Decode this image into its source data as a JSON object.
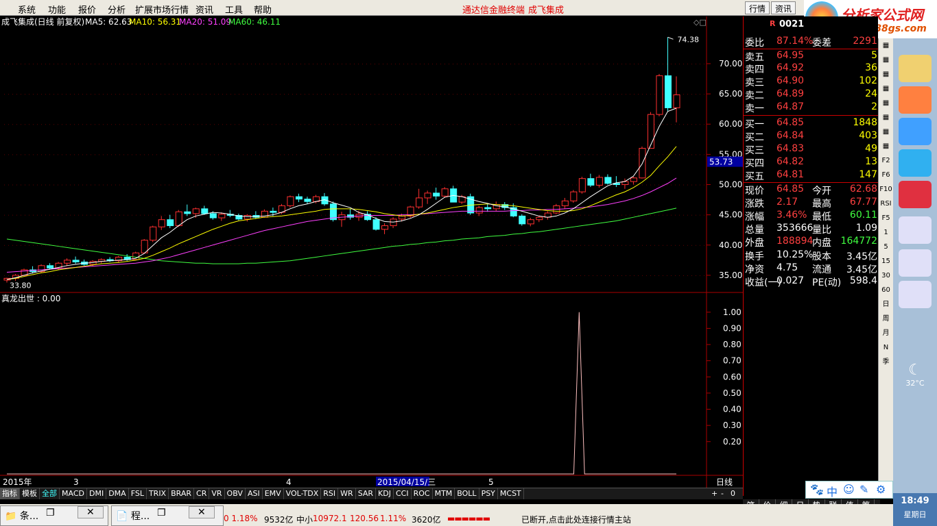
{
  "menu": {
    "items": [
      "系统",
      "功能",
      "报价",
      "分析",
      "扩展市场行情",
      "资讯",
      "工具",
      "帮助"
    ],
    "center": "通达信金融终端",
    "center2": "成飞集成",
    "btn1": "行情",
    "btn2": "资讯"
  },
  "logo": {
    "text": "分析家公式网",
    "url": "www.88gs.com"
  },
  "header": {
    "title": "成飞集成(日线 前复权)",
    "ma5": "MA5: 62.63",
    "ma10": "MA10: 56.31",
    "ma20": "MA20: 51.09",
    "ma60": "MA60: 46.11"
  },
  "colors": {
    "up": "#ff3030",
    "down": "#40ffff",
    "ma5": "#ffffff",
    "ma10": "#ffff00",
    "ma20": "#ff40ff",
    "ma60": "#40ff40",
    "grid": "#aa0000"
  },
  "chart_data": [
    {
      "type": "candlestick",
      "title": "成飞集成(日线 前复权)",
      "ylim": [
        32.5,
        76
      ],
      "yticks": [
        35,
        40,
        45,
        50,
        55,
        60,
        65,
        70
      ],
      "ytick_labels": [
        "35.00",
        "40.00",
        "45.00",
        "50.00",
        "55.00",
        "60.00",
        "65.00",
        "70.00"
      ],
      "high_label": "74.38",
      "low_label": "33.80",
      "price_marker": "53.73",
      "x_labels": [
        "2015年",
        "3",
        "4",
        "2015/04/15/三",
        "5",
        "日线"
      ],
      "candles": [
        [
          34.2,
          34.6,
          33.8,
          34.5
        ],
        [
          34.5,
          35.2,
          34.1,
          35.0
        ],
        [
          35.0,
          36.1,
          34.8,
          35.9
        ],
        [
          35.9,
          36.5,
          35.3,
          35.6
        ],
        [
          35.6,
          36.8,
          35.4,
          36.6
        ],
        [
          36.6,
          37.0,
          36.0,
          36.2
        ],
        [
          36.2,
          37.2,
          35.9,
          37.0
        ],
        [
          37.0,
          37.8,
          36.5,
          37.5
        ],
        [
          37.5,
          38.1,
          36.9,
          37.2
        ],
        [
          37.2,
          37.6,
          36.6,
          36.8
        ],
        [
          36.8,
          37.5,
          36.5,
          37.3
        ],
        [
          37.3,
          37.8,
          37.0,
          37.6
        ],
        [
          37.6,
          38.0,
          37.2,
          37.4
        ],
        [
          37.4,
          38.2,
          37.1,
          38.0
        ],
        [
          38.0,
          38.5,
          37.4,
          37.6
        ],
        [
          37.6,
          38.9,
          37.5,
          38.7
        ],
        [
          38.7,
          41.0,
          38.6,
          40.8
        ],
        [
          40.8,
          43.2,
          40.5,
          43.0
        ],
        [
          43.0,
          44.8,
          42.5,
          44.2
        ],
        [
          44.2,
          45.0,
          42.8,
          43.2
        ],
        [
          43.2,
          45.8,
          43.0,
          45.5
        ],
        [
          45.5,
          46.7,
          44.8,
          45.2
        ],
        [
          45.2,
          46.2,
          44.5,
          46.0
        ],
        [
          46.0,
          46.5,
          45.0,
          45.2
        ],
        [
          45.2,
          45.6,
          44.2,
          44.5
        ],
        [
          44.5,
          45.4,
          44.0,
          45.1
        ],
        [
          45.1,
          45.8,
          44.6,
          44.9
        ],
        [
          44.9,
          45.2,
          44.1,
          44.3
        ],
        [
          44.3,
          45.1,
          43.9,
          44.9
        ],
        [
          44.9,
          45.6,
          44.3,
          44.6
        ],
        [
          44.6,
          45.9,
          44.5,
          45.6
        ],
        [
          45.6,
          46.2,
          44.8,
          45.4
        ],
        [
          45.4,
          46.8,
          45.1,
          46.5
        ],
        [
          46.5,
          48.2,
          46.2,
          48.0
        ],
        [
          48.0,
          48.5,
          47.1,
          47.6
        ],
        [
          47.6,
          48.0,
          46.8,
          47.2
        ],
        [
          47.2,
          48.3,
          46.9,
          48.0
        ],
        [
          48.0,
          48.6,
          46.5,
          46.8
        ],
        [
          46.8,
          47.2,
          43.9,
          44.2
        ],
        [
          44.2,
          45.5,
          43.0,
          45.0
        ],
        [
          45.0,
          46.0,
          44.2,
          44.6
        ],
        [
          44.6,
          45.7,
          44.0,
          45.1
        ],
        [
          45.1,
          45.6,
          44.0,
          44.2
        ],
        [
          44.2,
          44.6,
          42.4,
          42.6
        ],
        [
          42.6,
          43.6,
          41.8,
          43.2
        ],
        [
          43.2,
          44.6,
          42.8,
          44.3
        ],
        [
          44.3,
          45.2,
          43.9,
          44.8
        ],
        [
          44.8,
          46.5,
          44.5,
          46.3
        ],
        [
          46.3,
          49.3,
          46.0,
          47.8
        ],
        [
          47.8,
          49.0,
          46.8,
          48.6
        ],
        [
          48.6,
          49.5,
          47.5,
          48.1
        ],
        [
          48.1,
          49.6,
          47.8,
          49.3
        ],
        [
          49.3,
          49.8,
          47.5,
          47.1
        ],
        [
          47.1,
          48.3,
          46.8,
          48.0
        ],
        [
          48.0,
          48.5,
          45.0,
          45.3
        ],
        [
          45.3,
          46.5,
          44.8,
          46.2
        ],
        [
          46.2,
          46.9,
          45.5,
          46.0
        ],
        [
          46.0,
          47.2,
          45.6,
          46.7
        ],
        [
          46.7,
          47.1,
          45.8,
          46.2
        ],
        [
          46.2,
          46.9,
          44.6,
          44.8
        ],
        [
          44.8,
          45.1,
          43.2,
          43.5
        ],
        [
          43.5,
          44.5,
          43.1,
          44.2
        ],
        [
          44.2,
          44.8,
          43.8,
          44.6
        ],
        [
          44.6,
          45.6,
          44.2,
          45.3
        ],
        [
          45.3,
          46.8,
          45.1,
          46.5
        ],
        [
          46.5,
          47.8,
          46.0,
          47.3
        ],
        [
          47.3,
          49.1,
          47.0,
          48.8
        ],
        [
          48.8,
          51.3,
          48.5,
          51.0
        ],
        [
          51.0,
          51.8,
          49.6,
          49.9
        ],
        [
          49.9,
          51.6,
          49.5,
          51.2
        ],
        [
          51.2,
          51.7,
          50.0,
          50.2
        ],
        [
          50.2,
          51.4,
          49.6,
          50.0
        ],
        [
          50.0,
          51.0,
          49.3,
          50.5
        ],
        [
          50.5,
          51.3,
          50.0,
          51.1
        ],
        [
          51.1,
          56.3,
          51.0,
          56.0
        ],
        [
          56.0,
          62.0,
          58.2,
          61.6
        ],
        [
          61.6,
          68.3,
          61.3,
          68.0
        ],
        [
          68.0,
          74.38,
          62.1,
          62.7
        ],
        [
          62.7,
          67.9,
          60.3,
          64.85
        ]
      ],
      "ma5": [
        34.3,
        34.6,
        35.0,
        35.4,
        35.7,
        36.0,
        36.3,
        36.6,
        36.8,
        37.0,
        37.1,
        37.3,
        37.4,
        37.5,
        37.6,
        37.8,
        38.6,
        39.9,
        41.2,
        42.1,
        43.2,
        44.2,
        44.8,
        45.1,
        45.4,
        45.3,
        45.1,
        44.8,
        44.7,
        44.7,
        44.8,
        45.0,
        45.4,
        46.0,
        46.5,
        46.8,
        47.2,
        47.5,
        47.0,
        46.6,
        46.2,
        45.4,
        45.0,
        44.4,
        43.9,
        43.8,
        44.0,
        44.4,
        45.0,
        45.9,
        46.9,
        47.9,
        48.2,
        48.0,
        47.6,
        47.2,
        46.9,
        46.5,
        46.3,
        46.0,
        45.6,
        45.2,
        44.8,
        44.6,
        44.8,
        45.3,
        46.0,
        47.0,
        48.0,
        48.9,
        49.8,
        50.3,
        50.5,
        51.4,
        53.4,
        56.5,
        59.6,
        62.1,
        62.63
      ],
      "ma10": [
        34.3,
        34.5,
        34.8,
        35.1,
        35.4,
        35.6,
        35.9,
        36.1,
        36.3,
        36.5,
        36.7,
        36.9,
        37.0,
        37.1,
        37.3,
        37.5,
        37.8,
        38.3,
        38.9,
        39.5,
        40.2,
        40.8,
        41.4,
        42.0,
        42.6,
        43.1,
        43.6,
        44.0,
        44.2,
        44.4,
        44.6,
        44.7,
        44.8,
        45.0,
        45.2,
        45.4,
        45.6,
        45.9,
        46.0,
        46.0,
        46.0,
        45.9,
        45.7,
        45.5,
        45.2,
        45.0,
        44.8,
        44.9,
        45.1,
        45.3,
        45.6,
        45.9,
        46.2,
        46.4,
        46.6,
        46.7,
        46.8,
        46.7,
        46.6,
        46.5,
        46.3,
        46.1,
        45.9,
        45.7,
        45.6,
        45.6,
        45.7,
        46.0,
        46.5,
        47.1,
        47.7,
        48.3,
        48.8,
        49.5,
        50.4,
        51.5,
        53.1,
        54.6,
        56.31
      ],
      "ma20": [
        35.5,
        35.6,
        35.7,
        35.8,
        35.9,
        36.0,
        36.1,
        36.2,
        36.3,
        36.4,
        36.5,
        36.6,
        36.7,
        36.8,
        36.9,
        37.0,
        37.2,
        37.4,
        37.7,
        38.0,
        38.4,
        38.8,
        39.2,
        39.6,
        40.0,
        40.4,
        40.8,
        41.2,
        41.6,
        42.0,
        42.4,
        42.7,
        43.0,
        43.3,
        43.6,
        43.9,
        44.1,
        44.3,
        44.5,
        44.6,
        44.7,
        44.8,
        44.9,
        44.9,
        44.9,
        44.9,
        45.0,
        45.0,
        45.1,
        45.2,
        45.3,
        45.4,
        45.5,
        45.6,
        45.6,
        45.6,
        45.6,
        45.6,
        45.6,
        45.7,
        45.7,
        45.8,
        45.8,
        45.9,
        45.9,
        46.0,
        46.1,
        46.2,
        46.3,
        46.5,
        46.7,
        47.0,
        47.3,
        47.7,
        48.2,
        48.8,
        49.5,
        50.2,
        51.09
      ],
      "ma60": [
        41.0,
        40.8,
        40.6,
        40.4,
        40.2,
        40.0,
        39.8,
        39.6,
        39.4,
        39.2,
        39.0,
        38.8,
        38.6,
        38.4,
        38.2,
        38.0,
        37.8,
        37.6,
        37.4,
        37.3,
        37.2,
        37.1,
        37.0,
        37.0,
        36.9,
        36.9,
        36.9,
        36.9,
        37.0,
        37.0,
        37.1,
        37.2,
        37.3,
        37.4,
        37.6,
        37.8,
        38.0,
        38.2,
        38.4,
        38.6,
        38.8,
        39.0,
        39.2,
        39.4,
        39.6,
        39.8,
        39.9,
        40.1,
        40.2,
        40.4,
        40.5,
        40.7,
        40.8,
        41.0,
        41.1,
        41.2,
        41.4,
        41.5,
        41.6,
        41.8,
        41.9,
        42.1,
        42.2,
        42.4,
        42.6,
        42.8,
        43.0,
        43.2,
        43.4,
        43.6,
        43.8,
        44.0,
        44.3,
        44.6,
        44.9,
        45.2,
        45.5,
        45.8,
        46.11
      ]
    },
    {
      "type": "line",
      "title": "真龙出世 : 0.00",
      "ylim": [
        0,
        1.05
      ],
      "yticks": [
        0.2,
        0.3,
        0.4,
        0.5,
        0.6,
        0.7,
        0.8,
        0.9,
        1.0
      ],
      "ytick_labels": [
        "0.20",
        "0.30",
        "0.40",
        "0.50",
        "0.60",
        "0.70",
        "0.80",
        "0.90",
        "1.00"
      ],
      "values": [
        0,
        0,
        0,
        0,
        0,
        0,
        0,
        0,
        0,
        0,
        0,
        0,
        0,
        0,
        0,
        0,
        0,
        0,
        0,
        0,
        0,
        0,
        0,
        0,
        0,
        0,
        0,
        0,
        0,
        0,
        0,
        0,
        0,
        0,
        0,
        0,
        0,
        0,
        0,
        0,
        0,
        0,
        0,
        0,
        0,
        0,
        0,
        0,
        0,
        0,
        0,
        0,
        0,
        0,
        0,
        0,
        0,
        0,
        0,
        0,
        0,
        0,
        0,
        0,
        0,
        0,
        0,
        0,
        0,
        0,
        0,
        0,
        0,
        0,
        0,
        0,
        0,
        0,
        0,
        0,
        0,
        0,
        0,
        0,
        0,
        0,
        0,
        0,
        0,
        0,
        0,
        0,
        0,
        0,
        0,
        0,
        0,
        0,
        0,
        0,
        0,
        0,
        0,
        0,
        0,
        0,
        1,
        0,
        0,
        0,
        0,
        0,
        0,
        0,
        0,
        0,
        0,
        0,
        0,
        0,
        0,
        0,
        0,
        0,
        0
      ]
    }
  ],
  "tabs": [
    "指标",
    "模板",
    "全部",
    "MACD",
    "DMI",
    "DMA",
    "FSL",
    "TRIX",
    "BRAR",
    "CR",
    "VR",
    "OBV",
    "ASI",
    "EMV",
    "VOL-TDX",
    "RSI",
    "WR",
    "SAR",
    "KDJ",
    "CCI",
    "ROC",
    "MTM",
    "BOLL",
    "PSY",
    "MCST"
  ],
  "tabs_right": [
    "+",
    "-",
    "0"
  ],
  "quote": {
    "code": "0021",
    "flag": "R",
    "rows": [
      {
        "l": "委比",
        "p": "87.14%",
        "l2": "委差",
        "v": "2291"
      },
      {
        "l": "卖五",
        "p": "64.95",
        "v": "5"
      },
      {
        "l": "卖四",
        "p": "64.92",
        "v": "36"
      },
      {
        "l": "卖三",
        "p": "64.90",
        "v": "102"
      },
      {
        "l": "卖二",
        "p": "64.89",
        "v": "24"
      },
      {
        "l": "卖一",
        "p": "64.87",
        "v": "2"
      },
      {
        "l": "买一",
        "p": "64.85",
        "v": "1848"
      },
      {
        "l": "买二",
        "p": "64.84",
        "v": "403"
      },
      {
        "l": "买三",
        "p": "64.83",
        "v": "49"
      },
      {
        "l": "买四",
        "p": "64.82",
        "v": "13"
      },
      {
        "l": "买五",
        "p": "64.81",
        "v": "147"
      },
      {
        "l": "现价",
        "p": "64.85",
        "l2": "今开",
        "v": "62.68"
      },
      {
        "l": "涨跌",
        "p": "2.17",
        "l2": "最高",
        "v": "67.77"
      },
      {
        "l": "涨幅",
        "p": "3.46%",
        "l2": "最低",
        "v": "60.11"
      },
      {
        "l": "总量",
        "p": "353666",
        "l2": "量比",
        "v": "1.09"
      },
      {
        "l": "外盘",
        "p": "188894",
        "l2": "内盘",
        "v": "164772"
      },
      {
        "l": "换手",
        "p": "10.25%",
        "l2": "股本",
        "v": "3.45亿"
      },
      {
        "l": "净资",
        "p": "4.75",
        "l2": "流通",
        "v": "3.45亿"
      },
      {
        "l": "收益(一)",
        "p": "0.027",
        "l2": "PE(动)",
        "v": "598.4"
      }
    ]
  },
  "sidebar": [
    "F2",
    "F6",
    "F10",
    "RSI",
    "F5",
    "1",
    "5",
    "15",
    "30",
    "60",
    "日",
    "周",
    "月",
    "N",
    "季"
  ],
  "bottom_tabs": [
    "笔",
    "价",
    "细",
    "日",
    "势",
    "联",
    "值",
    "筹"
  ],
  "status": {
    "s1": "0 1.18%",
    "s2": "9532亿",
    "s3": "中小",
    "s4": "10972.1",
    "s5": "120.56",
    "s6": "1.11%",
    "s7": "3620亿",
    "s8": "已断开,点击此处连接行情主站"
  },
  "task": {
    "w1": "条...",
    "w2": "程..."
  },
  "clock": {
    "temp": "32°C",
    "time": "18:49",
    "day": "星期日"
  }
}
